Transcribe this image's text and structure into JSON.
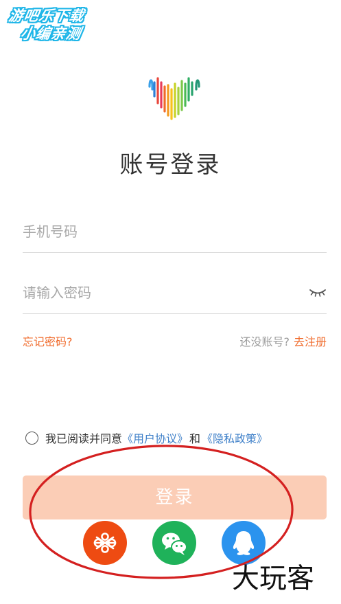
{
  "watermark": {
    "line1": "游吧乐下载",
    "line2": "小编亲测",
    "bottom": "大玩客"
  },
  "colors": {
    "accent": "#f06b2c",
    "link_blue": "#3f80c9",
    "login_button_bg": "#fbcdb6",
    "unicom": "#ee4b12",
    "wechat": "#1fb25a",
    "qq": "#2b93ee",
    "annotation": "#d42020"
  },
  "logo": {
    "icon": "rainbow-soundwave-heart-icon"
  },
  "title": "账号登录",
  "form": {
    "phone_placeholder": "手机号码",
    "phone_value": "",
    "password_placeholder": "请输入密码",
    "password_value": "",
    "eye_icon": "eye-closed-icon"
  },
  "links": {
    "forgot": "忘记密码?",
    "no_account": "还没账号?",
    "register": "去注册"
  },
  "agreement": {
    "checked": false,
    "prefix": "我已阅读并同意",
    "user_agreement": "《用户协议》",
    "and": "和",
    "privacy_policy": "《隐私政策》"
  },
  "login_button": "登录",
  "social": [
    {
      "name": "china-unicom",
      "icon": "china-unicom-knot-icon"
    },
    {
      "name": "wechat",
      "icon": "wechat-icon"
    },
    {
      "name": "qq",
      "icon": "qq-penguin-icon"
    }
  ]
}
